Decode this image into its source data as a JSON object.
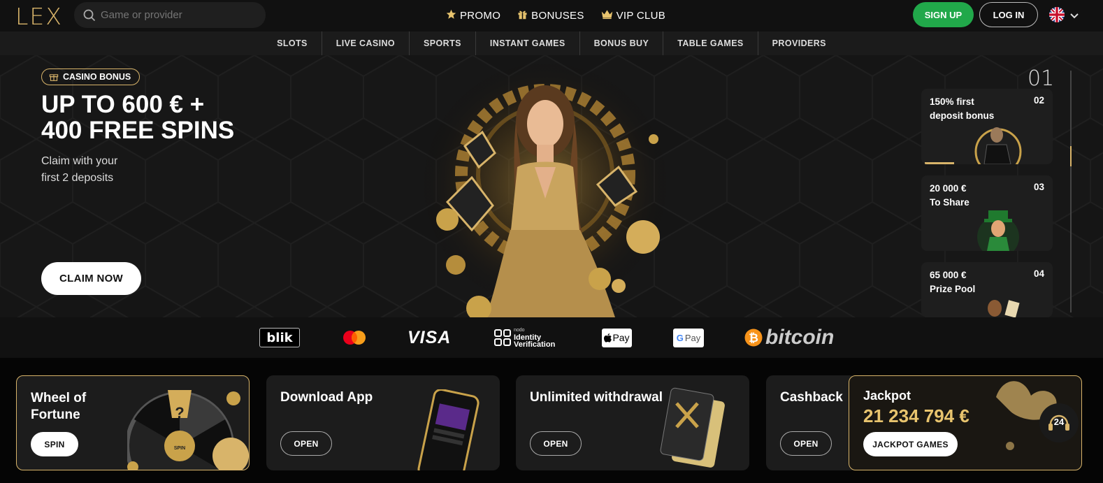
{
  "header": {
    "logo": "LEX",
    "search": {
      "placeholder": "Game or provider"
    },
    "nav": [
      {
        "label": "PROMO",
        "icon": "star-icon"
      },
      {
        "label": "BONUSES",
        "icon": "gift-icon"
      },
      {
        "label": "VIP CLUB",
        "icon": "crown-icon"
      }
    ],
    "signup_label": "SIGN UP",
    "login_label": "LOG IN",
    "language_icon": "uk-flag-icon"
  },
  "categories": [
    "SLOTS",
    "LIVE CASINO",
    "SPORTS",
    "INSTANT GAMES",
    "BONUS BUY",
    "TABLE GAMES",
    "PROVIDERS"
  ],
  "hero": {
    "badge": "CASINO BONUS",
    "headline_line1": "UP TO 600 € +",
    "headline_line2": "400 FREE SPINS",
    "subtitle_line1": "Claim with your",
    "subtitle_line2": "first 2 deposits",
    "cta_label": "CLAIM NOW",
    "current_slide": "01",
    "slides": [
      {
        "title_line1": "150% first",
        "title_line2": "deposit bonus",
        "number": "02"
      },
      {
        "title_line1": "20 000 €",
        "title_line2": "To Share",
        "number": "03"
      },
      {
        "title_line1": "65 000 €",
        "title_line2": "Prize Pool",
        "number": "04"
      }
    ]
  },
  "payments": {
    "blik": "blik",
    "nodo_small": "nodo",
    "identity_line1": "Identity",
    "identity_line2": "Verification",
    "visa": "VISA",
    "applepay": "Pay",
    "googlepay": "Pay",
    "bitcoin": "bitcoin"
  },
  "cards": {
    "wheel": {
      "title_line1": "Wheel of",
      "title_line2": "Fortune",
      "button": "SPIN",
      "wheel_label": "SPIN"
    },
    "app": {
      "title": "Download App",
      "button": "OPEN"
    },
    "withdrawal": {
      "title": "Unlimited withdrawal",
      "button": "OPEN"
    },
    "cashback": {
      "title": "Cashback",
      "button": "OPEN"
    },
    "jackpot": {
      "title": "Jackpot",
      "amount": "21 234 794 €",
      "button": "JACKPOT GAMES"
    }
  },
  "support_label": "24",
  "colors": {
    "gold": "#d8b46a",
    "green": "#21a84a",
    "bg": "#0d0d0d"
  }
}
